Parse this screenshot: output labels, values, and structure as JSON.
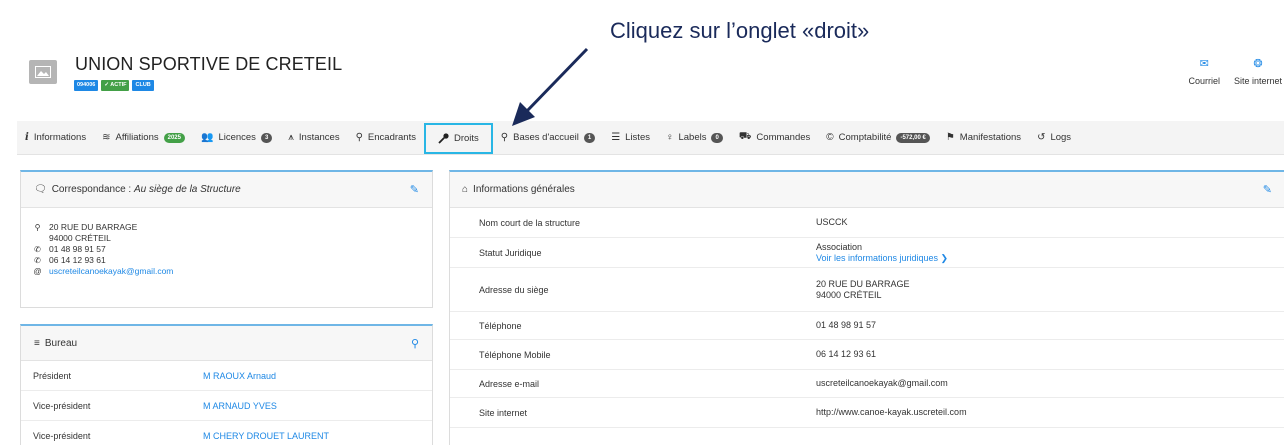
{
  "annotation": {
    "text": "Cliquez sur l’onglet «droit»"
  },
  "header": {
    "title": "UNION SPORTIVE DE CRETEIL",
    "badges": [
      {
        "label": "094006",
        "color": "#1e88e5"
      },
      {
        "label": "✓ ACTIF",
        "color": "#43a047"
      },
      {
        "label": "CLUB",
        "color": "#1e88e5"
      }
    ],
    "actions": [
      {
        "icon": "envelope-icon",
        "label": "Courriel"
      },
      {
        "icon": "globe-icon",
        "label": "Site internet"
      }
    ]
  },
  "tabs": [
    {
      "icon": "info-icon",
      "label": "Informations"
    },
    {
      "icon": "layers-icon",
      "label": "Affiliations",
      "count": "2025"
    },
    {
      "icon": "users-icon",
      "label": "Licences",
      "count": "3"
    },
    {
      "icon": "hierarchy-icon",
      "label": "Instances"
    },
    {
      "icon": "user-tie-icon",
      "label": "Encadrants"
    },
    {
      "icon": "key-icon",
      "label": "Droits"
    },
    {
      "icon": "map-pin-icon",
      "label": "Bases d'accueil",
      "count": "1"
    },
    {
      "icon": "list-icon",
      "label": "Listes"
    },
    {
      "icon": "label-pin-icon",
      "label": "Labels",
      "count": "0"
    },
    {
      "icon": "cart-icon",
      "label": "Commandes"
    },
    {
      "icon": "copyright-icon",
      "label": "Comptabilité",
      "count": "-572,00 €"
    },
    {
      "icon": "flag-icon",
      "label": "Manifestations"
    },
    {
      "icon": "history-icon",
      "label": "Logs"
    }
  ],
  "correspondance": {
    "title": "Correspondance : ",
    "title_em": "Au siège de la Structure",
    "address_line1": "20 RUE DU BARRAGE",
    "address_line2": "94000 CRÉTEIL",
    "phone1": "01 48 98 91 57",
    "phone2": "06 14 12 93 61",
    "email": "uscreteilcanoekayak@gmail.com"
  },
  "bureau": {
    "title": "Bureau",
    "rows": [
      {
        "role": "Président",
        "name": "M RAOUX Arnaud"
      },
      {
        "role": "Vice-président",
        "name": "M ARNAUD YVES"
      },
      {
        "role": "Vice-président",
        "name": "M CHERY DROUET LAURENT"
      }
    ]
  },
  "infos": {
    "title": "Informations générales",
    "short_name_label": "Nom court de la structure",
    "short_name": "USCCK",
    "statut_label": "Statut Juridique",
    "statut": "Association",
    "statut_link": "Voir les informations juridiques  ❯",
    "siege_label": "Adresse du siège",
    "siege_line1": "20 RUE DU BARRAGE",
    "siege_line2": "94000 CRÉTEIL",
    "tel_label": "Téléphone",
    "tel": "01 48 98 91 57",
    "mobile_label": "Téléphone Mobile",
    "mobile": "06 14 12 93 61",
    "email_label": "Adresse e-mail",
    "email": "uscreteilcanoekayak@gmail.com",
    "site_label": "Site internet",
    "site": "http://www.canoe-kayak.uscreteil.com"
  }
}
